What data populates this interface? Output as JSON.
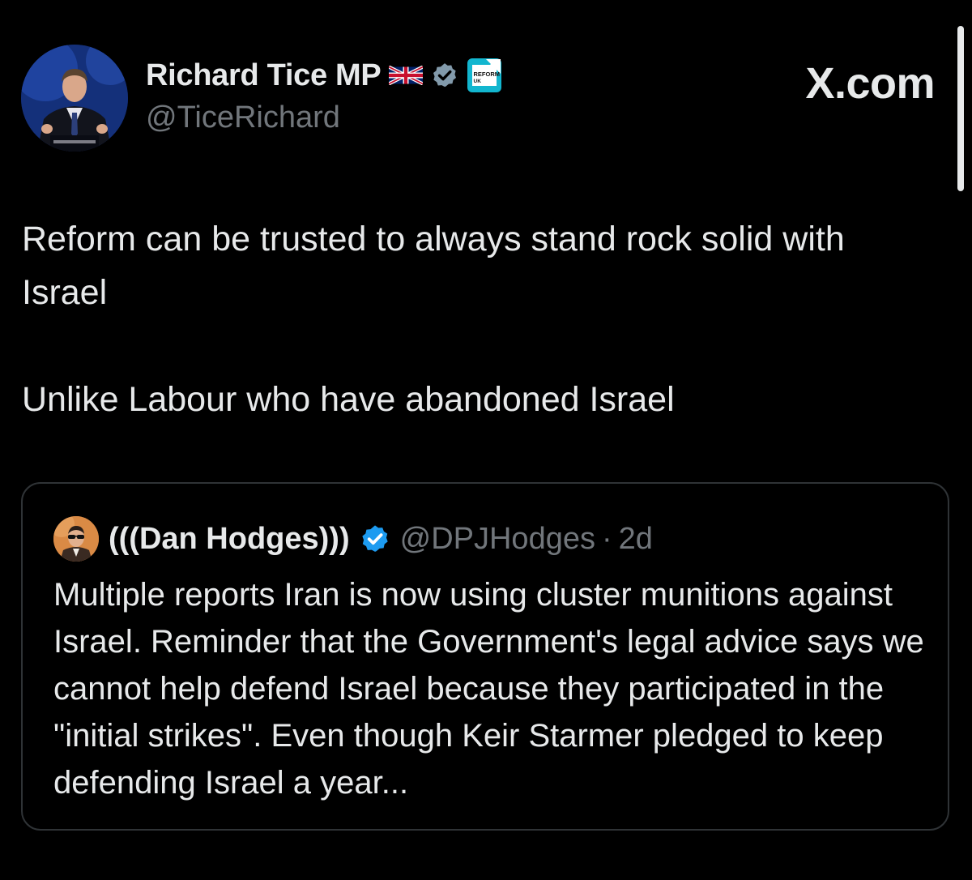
{
  "author": {
    "display_name": "Richard Tice MP",
    "handle": "@TiceRichard",
    "avatar_icon": "profile-photo",
    "badges": [
      "uk-flag-icon",
      "verified-icon",
      "reform-uk-icon"
    ],
    "reform_badge_text_top": "REFORM",
    "reform_badge_text_bottom": "UK",
    "verified_color": "#829aab"
  },
  "site_label": "X.com",
  "tweet": {
    "paragraph_1": "Reform can be trusted to always stand rock solid with Israel",
    "paragraph_2": "Unlike Labour who have abandoned Israel"
  },
  "quote": {
    "display_name": "(((Dan Hodges)))",
    "handle": "@DPJHodges",
    "separator": "·",
    "time": "2d",
    "verified_color": "#1d9bf0",
    "text": "Multiple reports Iran is now using cluster munitions against Israel. Reminder that the Government's legal advice says we cannot help defend Israel because they participated in the \"initial strikes\". Even though Keir Starmer pledged to keep defending Israel a year..."
  },
  "colors": {
    "background": "#000000",
    "text_primary": "#e7e9ea",
    "text_secondary": "#71767b",
    "border": "#2f3336",
    "reform_teal": "#12b6cf"
  }
}
